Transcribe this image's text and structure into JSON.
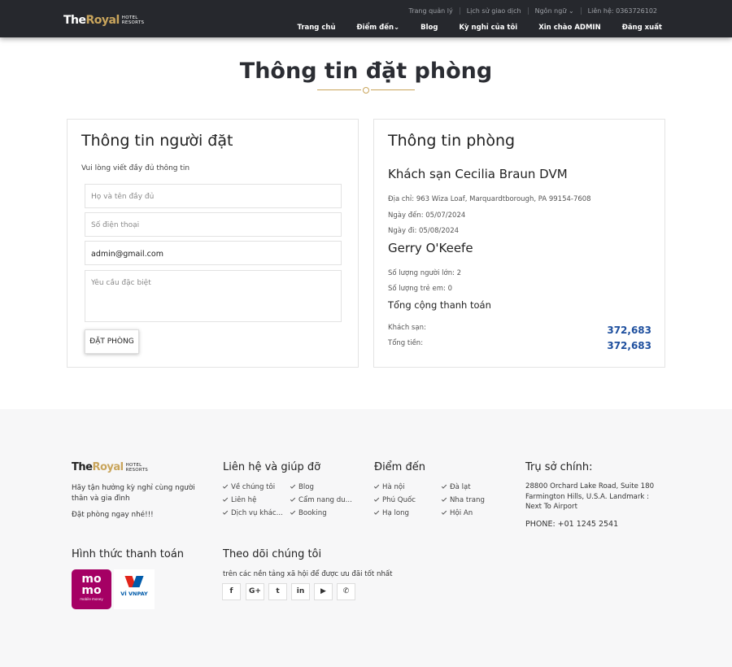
{
  "header": {
    "logo_the": "The",
    "logo_royal": "Royal",
    "logo_sub1": "HOTEL",
    "logo_sub2": "RESORTS",
    "topbar": [
      "Trang quản lý",
      "Lịch sử giao dịch",
      "Ngôn ngữ ⌄",
      "Liên hệ: 0363726102"
    ],
    "nav": [
      "Trang chủ",
      "Điểm đến⌄",
      "Blog",
      "Kỳ nghỉ của tôi",
      "Xin chào ADMIN",
      "Đăng xuất"
    ]
  },
  "page_title": "Thông tin đặt phòng",
  "booker": {
    "title": "Thông tin người đặt",
    "hint": "Vui lòng viết đầy đủ thông tin",
    "name_placeholder": "Họ và tên đầy đủ",
    "phone_placeholder": "Số điện thoại",
    "email_value": "admin@gmail.com",
    "request_placeholder": "Yêu cầu đặc biệt",
    "book_button": "ĐẶT PHÒNG"
  },
  "room": {
    "title": "Thông tin phòng",
    "hotel_name": "Khách sạn Cecilia Braun DVM",
    "address": "Địa chỉ: 963 Wiza Loaf, Marquardtborough, PA 99154-7608",
    "checkin": "Ngày đến: 05/07/2024",
    "checkout": "Ngày đi: 05/08/2024",
    "guest_name": "Gerry O'Keefe",
    "adults": "Số lượng người lớn: 2",
    "children": "Số lượng trẻ em: 0",
    "summary_title": "Tổng cộng thanh toán",
    "hotel_label": "Khách sạn:",
    "hotel_amount": "372,683",
    "total_label": "Tổng tiền:",
    "total_amount": "372,683"
  },
  "footer": {
    "logo_the": "The",
    "logo_royal": "Royal",
    "logo_sub1": "HOTEL",
    "logo_sub2": "RESORTS",
    "tagline": "Hãy tận hưởng kỳ nghỉ cùng người thân và gia đình",
    "cta": "Đặt phòng ngay nhé!!!",
    "help_title": "Liên hệ và giúp đỡ",
    "help_links": [
      "Về chúng tôi",
      "Blog",
      "Liên hệ",
      "Cẩm nang du...",
      "Dịch vụ khác...",
      "Booking"
    ],
    "dest_title": "Điểm đến",
    "dest_links": [
      "Hà nội",
      "Đà lạt",
      "Phú Quốc",
      "Nha trang",
      "Hạ long",
      "Hội An"
    ],
    "hq_title": "Trụ sở chính:",
    "hq_address": "28800 Orchard Lake Road, Suite 180 Farmington Hills, U.S.A. Landmark : Next To Airport",
    "hq_phone": "PHONE: +01 1245 2541",
    "pay_title": "Hình thức thanh toán",
    "momo_line1": "mo",
    "momo_line2": "mo",
    "momo_sub": "mobile money",
    "vnpay_label": "VÍ VNPAY",
    "follow_title": "Theo dõi chúng tôi",
    "follow_sub": "trên các nền tảng xã hội để được ưu đãi tốt nhất",
    "social": [
      "f",
      "G+",
      "t",
      "in",
      "▶",
      "✆"
    ]
  }
}
